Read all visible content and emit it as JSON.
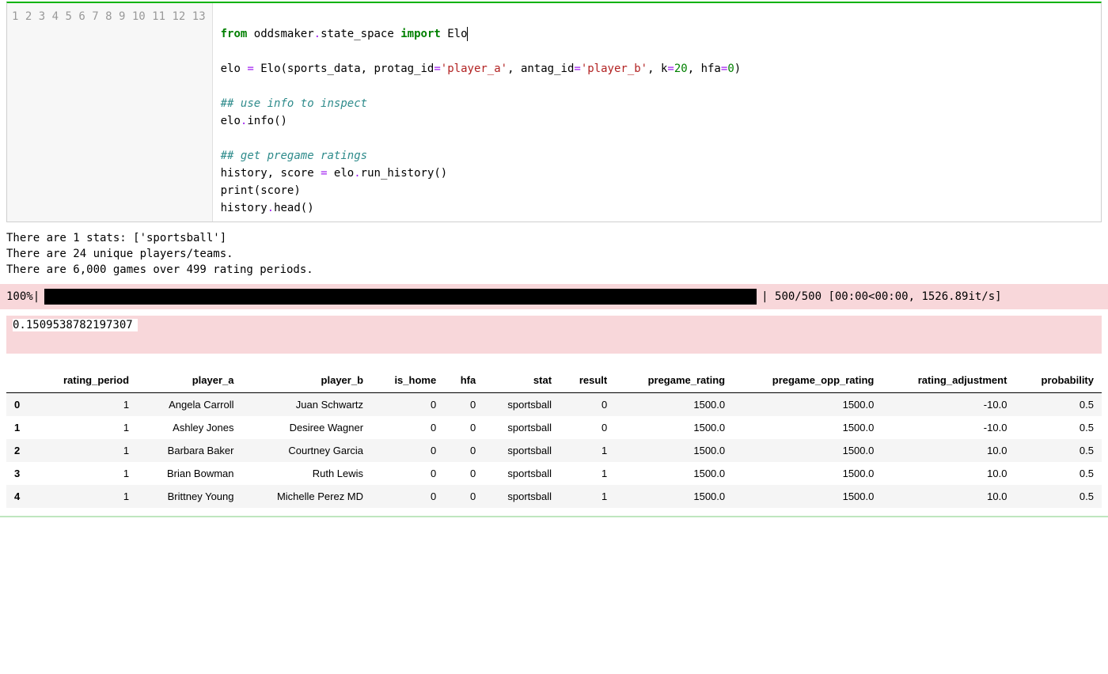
{
  "code": {
    "lines": [
      "1",
      "2",
      "3",
      "4",
      "5",
      "6",
      "7",
      "8",
      "9",
      "10",
      "11",
      "12",
      "13"
    ],
    "l2_kw1": "from",
    "l2_mod": " oddsmaker",
    "l2_dot1": ".",
    "l2_sub": "state_space ",
    "l2_kw2": "import",
    "l2_cls": " Elo",
    "l4_a": "elo ",
    "l4_eq": "=",
    "l4_b": " Elo(sports_data, protag_id",
    "l4_eq2": "=",
    "l4_s1": "'player_a'",
    "l4_c": ", antag_id",
    "l4_eq3": "=",
    "l4_s2": "'player_b'",
    "l4_d": ", k",
    "l4_eq4": "=",
    "l4_n1": "20",
    "l4_e": ", hfa",
    "l4_eq5": "=",
    "l4_n2": "0",
    "l4_f": ")",
    "l6_cmt": "## use info to inspect",
    "l7": "elo",
    "l7_dot": ".",
    "l7_b": "info()",
    "l9_cmt": "## get pregame ratings",
    "l10_a": "history, score ",
    "l10_eq": "=",
    "l10_b": " elo",
    "l10_dot": ".",
    "l10_c": "run_history()",
    "l11_a": "print",
    "l11_b": "(score)",
    "l12_a": "history",
    "l12_dot": ".",
    "l12_b": "head()"
  },
  "output_info": "There are 1 stats: ['sportsball']\nThere are 24 unique players/teams.\nThere are 6,000 games over 499 rating periods.",
  "progress": {
    "pct": "100%|",
    "suffix": "| 500/500 [00:00<00:00, 1526.89it/s]"
  },
  "score": "0.1509538782197307",
  "table": {
    "columns": [
      "rating_period",
      "player_a",
      "player_b",
      "is_home",
      "hfa",
      "stat",
      "result",
      "pregame_rating",
      "pregame_opp_rating",
      "rating_adjustment",
      "probability"
    ],
    "rows": [
      {
        "idx": "0",
        "rating_period": "1",
        "player_a": "Angela Carroll",
        "player_b": "Juan Schwartz",
        "is_home": "0",
        "hfa": "0",
        "stat": "sportsball",
        "result": "0",
        "pregame_rating": "1500.0",
        "pregame_opp_rating": "1500.0",
        "rating_adjustment": "-10.0",
        "probability": "0.5"
      },
      {
        "idx": "1",
        "rating_period": "1",
        "player_a": "Ashley Jones",
        "player_b": "Desiree Wagner",
        "is_home": "0",
        "hfa": "0",
        "stat": "sportsball",
        "result": "0",
        "pregame_rating": "1500.0",
        "pregame_opp_rating": "1500.0",
        "rating_adjustment": "-10.0",
        "probability": "0.5"
      },
      {
        "idx": "2",
        "rating_period": "1",
        "player_a": "Barbara Baker",
        "player_b": "Courtney Garcia",
        "is_home": "0",
        "hfa": "0",
        "stat": "sportsball",
        "result": "1",
        "pregame_rating": "1500.0",
        "pregame_opp_rating": "1500.0",
        "rating_adjustment": "10.0",
        "probability": "0.5"
      },
      {
        "idx": "3",
        "rating_period": "1",
        "player_a": "Brian Bowman",
        "player_b": "Ruth Lewis",
        "is_home": "0",
        "hfa": "0",
        "stat": "sportsball",
        "result": "1",
        "pregame_rating": "1500.0",
        "pregame_opp_rating": "1500.0",
        "rating_adjustment": "10.0",
        "probability": "0.5"
      },
      {
        "idx": "4",
        "rating_period": "1",
        "player_a": "Brittney Young",
        "player_b": "Michelle Perez MD",
        "is_home": "0",
        "hfa": "0",
        "stat": "sportsball",
        "result": "1",
        "pregame_rating": "1500.0",
        "pregame_opp_rating": "1500.0",
        "rating_adjustment": "10.0",
        "probability": "0.5"
      }
    ]
  }
}
